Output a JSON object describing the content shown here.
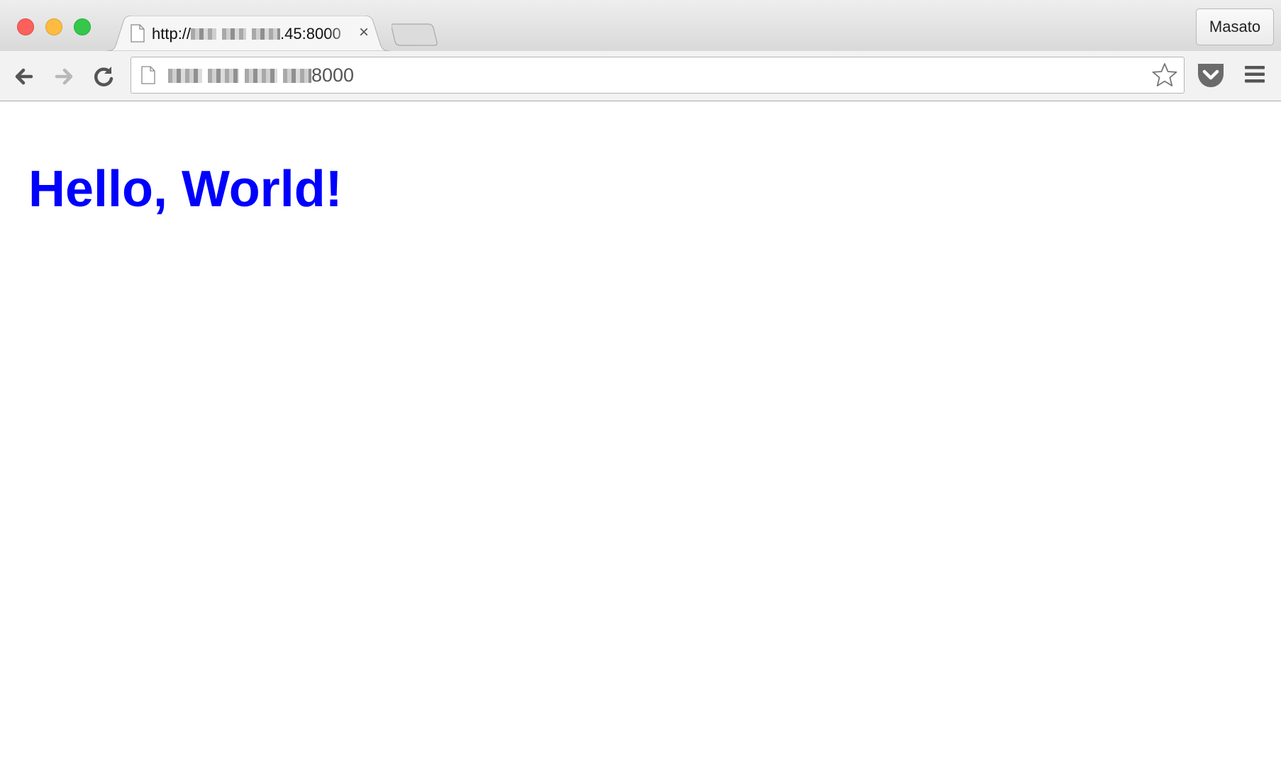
{
  "window": {
    "profile_name": "Masato"
  },
  "tab": {
    "title_prefix": "http://",
    "title_suffix": ".45:8000",
    "close_glyph": "×"
  },
  "address_bar": {
    "url_suffix": "8000"
  },
  "icons": {
    "favicon": "page-icon",
    "back": "back-arrow-icon",
    "forward": "forward-arrow-icon",
    "reload": "reload-icon",
    "bookmark": "star-icon",
    "pocket": "pocket-icon",
    "menu": "hamburger-menu-icon"
  },
  "page": {
    "heading": "Hello, World!",
    "heading_color": "#0000ff"
  },
  "colors": {
    "close": "#fc605c",
    "minimize": "#fdbc40",
    "maximize": "#34c84a"
  }
}
